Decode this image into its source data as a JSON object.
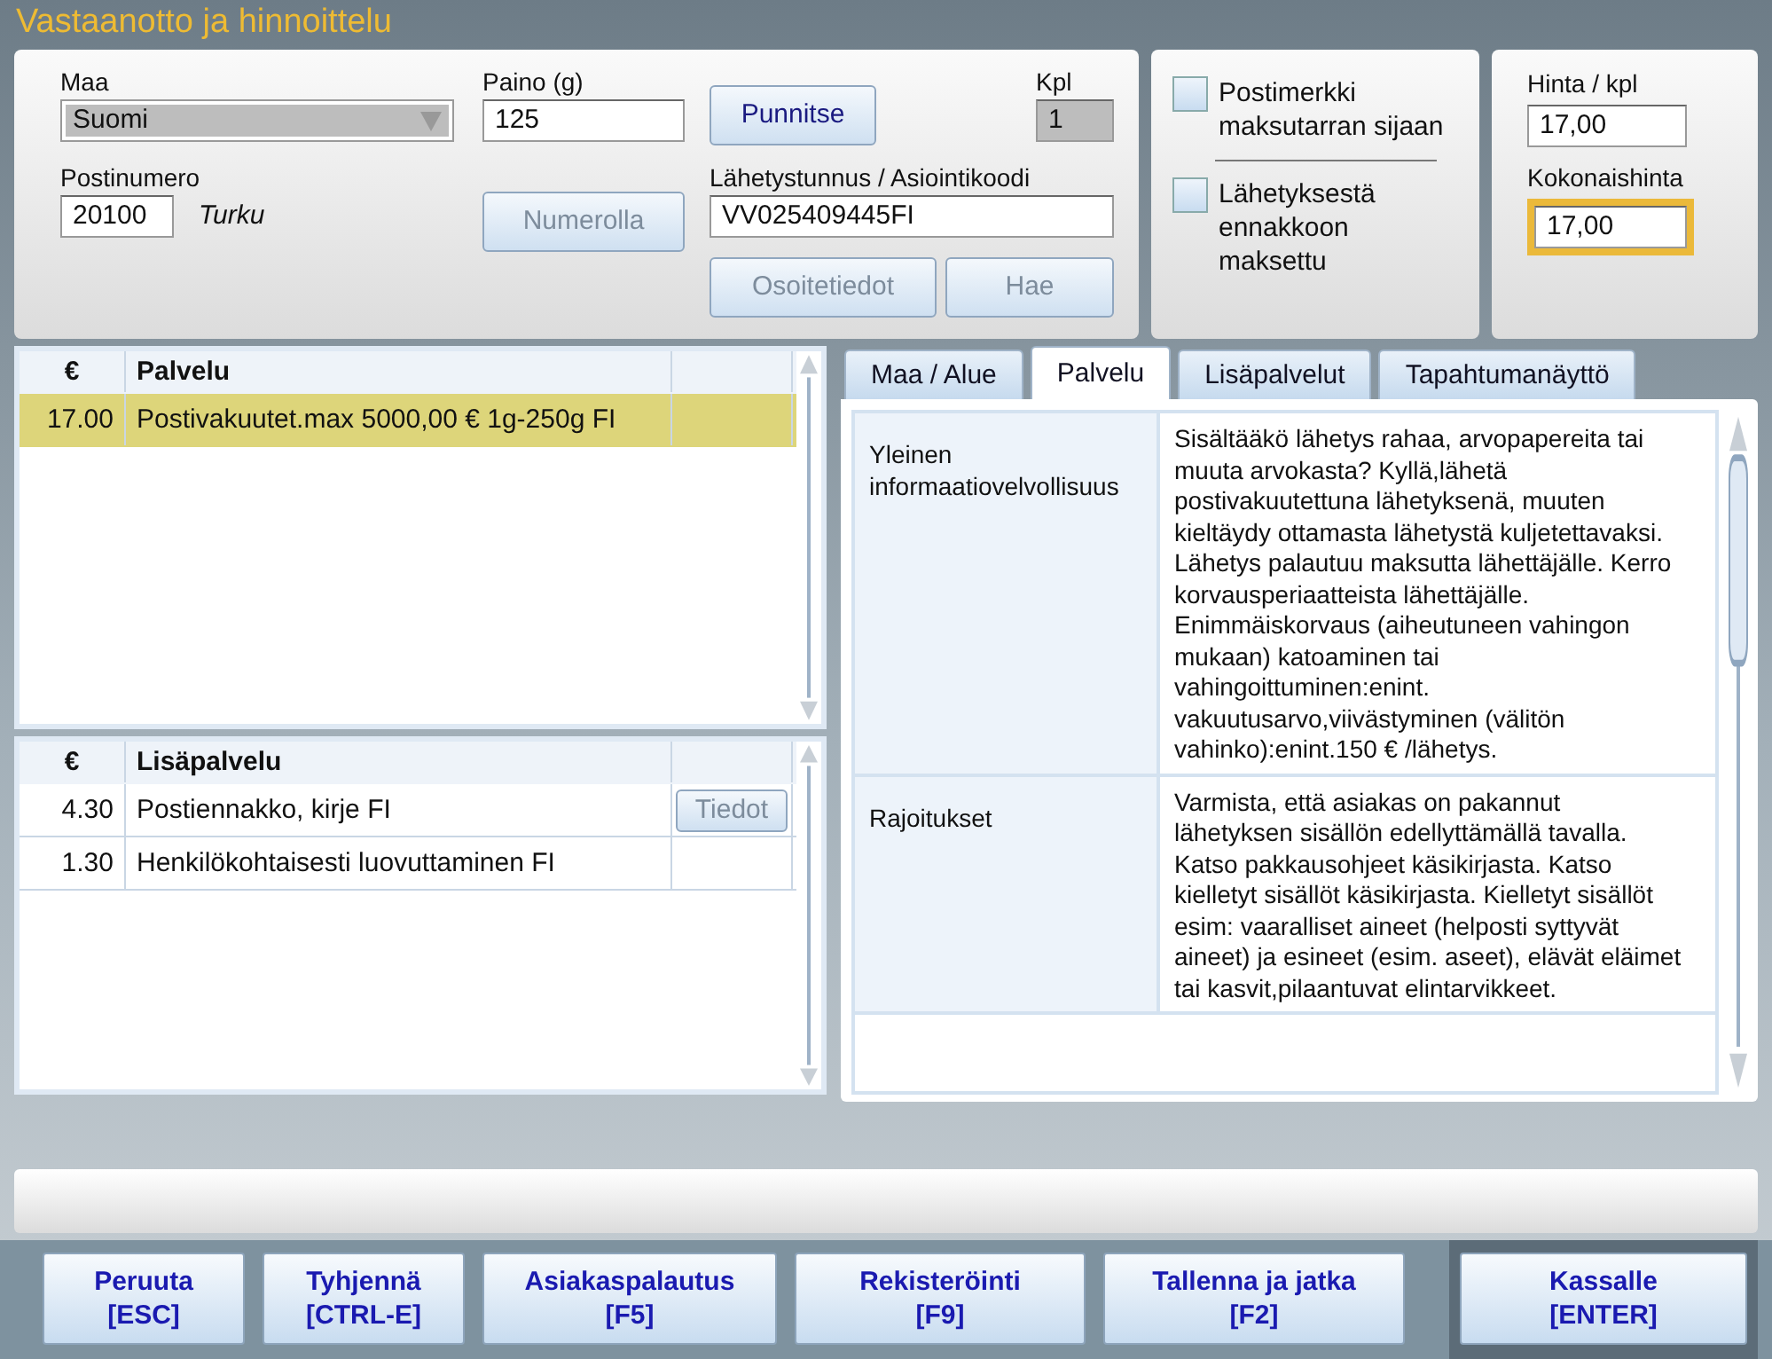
{
  "title": "Vastaanotto ja hinnoittelu",
  "form": {
    "country": {
      "label": "Maa",
      "value": "Suomi"
    },
    "weight": {
      "label": "Paino (g)",
      "value": "125"
    },
    "weigh_button": {
      "label": "Punnitse",
      "disabled": false
    },
    "count": {
      "label": "Kpl",
      "value": "1"
    },
    "postcode": {
      "label": "Postinumero",
      "value": "20100",
      "city": "Turku"
    },
    "number_button": {
      "label": "Numerolla",
      "disabled": true
    },
    "tracking": {
      "label": "Lähetystunnus / Asiointikoodi",
      "value": "VV025409445FI"
    },
    "address_button": {
      "label": "Osoitetiedot",
      "disabled": true
    },
    "search_button": {
      "label": "Hae",
      "disabled": true
    }
  },
  "options": [
    {
      "label": "Postimerkki maksutarran sijaan",
      "checked": false
    },
    {
      "label": "Lähetyksestä ennakkoon maksettu",
      "checked": false
    }
  ],
  "pricing": {
    "unit_label": "Hinta / kpl",
    "unit_value": "17,00",
    "total_label": "Kokonaishinta",
    "total_value": "17,00",
    "highlighted": true
  },
  "services": {
    "columns": [
      "€",
      "Palvelu"
    ],
    "rows": [
      {
        "price": "17.00",
        "name": "Postivakuutet.max 5000,00 € 1g-250g FI",
        "selected": true
      }
    ]
  },
  "additional": {
    "columns": [
      "€",
      "Lisäpalvelu"
    ],
    "rows": [
      {
        "price": "4.30",
        "name": "Postiennakko, kirje FI",
        "selected": false,
        "action": {
          "label": "Tiedot",
          "disabled": true
        }
      },
      {
        "price": "1.30",
        "name": "Henkilökohtaisesti luovuttaminen FI",
        "selected": false
      }
    ]
  },
  "tabs": [
    {
      "label": "Maa / Alue",
      "selected": false
    },
    {
      "label": "Palvelu",
      "selected": true
    },
    {
      "label": "Lisäpalvelut",
      "selected": false
    },
    {
      "label": "Tapahtumanäyttö",
      "selected": false
    }
  ],
  "info": [
    {
      "label": "Yleinen informaatiovelvollisuus",
      "text": "Sisältääkö lähetys rahaa, arvopapereita tai muuta arvokasta? Kyllä,lähetä postivakuutettuna lähetyksenä, muuten kieltäydy ottamasta lähetystä kuljetettavaksi. Lähetys palautuu maksutta lähettäjälle. Kerro korvausperiaatteista lähettäjälle. Enimmäiskorvaus (aiheutuneen vahingon mukaan) katoaminen tai vahingoittuminen:enint. vakuutusarvo,viivästyminen (välitön vahinko):enint.150 € /lähetys."
    },
    {
      "label": "Rajoitukset",
      "text": "Varmista, että asiakas on pakannut lähetyksen sisällön edellyttämällä tavalla. Katso pakkausohjeet käsikirjasta. Katso kielletyt sisällöt käsikirjasta. Kielletyt sisällöt esim: vaaralliset aineet (helposti syttyvät aineet) ja esineet (esim. aseet), elävät eläimet tai kasvit,pilaantuvat elintarvikkeet."
    }
  ],
  "actions": [
    {
      "label": "Peruuta",
      "key": "[ESC]",
      "kind": "normal"
    },
    {
      "label": "Tyhjennä",
      "key": "[CTRL-E]",
      "kind": "normal"
    },
    {
      "label": "Asiakaspalautus",
      "key": "[F5]",
      "kind": "normal"
    },
    {
      "label": "Rekisteröinti",
      "key": "[F9]",
      "kind": "normal"
    },
    {
      "label": "Tallenna ja jatka",
      "key": "[F2]",
      "kind": "normal"
    },
    {
      "label": "Kassalle",
      "key": "[ENTER]",
      "kind": "primary"
    }
  ]
}
